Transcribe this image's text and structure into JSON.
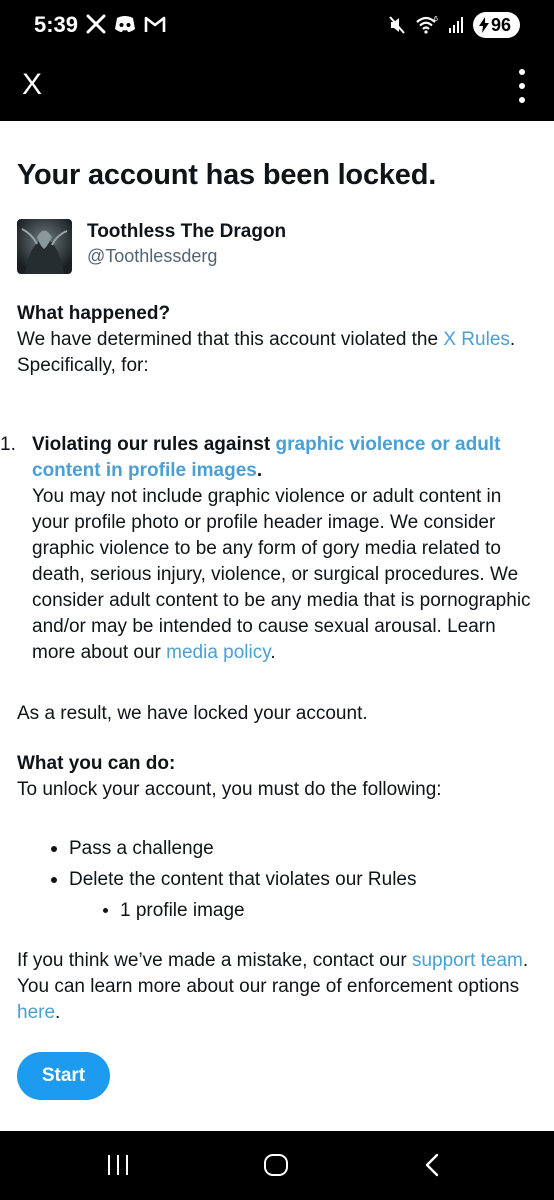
{
  "status_bar": {
    "time": "5:39",
    "battery": "96",
    "left_icons": [
      "x-logo-icon",
      "discord-icon",
      "gmail-icon"
    ],
    "right_icons": [
      "mute-icon",
      "wifi-icon",
      "signal-icon",
      "battery-icon"
    ]
  },
  "app_bar": {
    "close_icon": "close-icon",
    "close_glyph": "X",
    "more_icon": "more-vertical-icon"
  },
  "page": {
    "title": "Your account has been locked.",
    "profile": {
      "display_name": "Toothless The Dragon",
      "handle": "@Toothlessderg"
    },
    "what_happened": {
      "heading": "What happened?",
      "text_before": "We have determined that this account violated the ",
      "link": "X Rules",
      "text_after": ". Specifically, for:"
    },
    "violation": {
      "number": "1.",
      "lead": "Violating our rules against ",
      "lead_link": "graphic violence or adult content in profile images",
      "lead_end": ".",
      "body": "You may not include graphic violence or adult content in your profile photo or profile header image. We consider graphic violence to be any form of gory media related to death, serious injury, violence, or surgical procedures. We consider adult content to be any media that is pornographic and/or may be intended to cause sexual arousal. Learn more about our ",
      "body_link": "media policy",
      "body_end": "."
    },
    "result": "As a result, we have locked your account.",
    "what_you_can_do": {
      "heading": "What you can do:",
      "text": "To unlock your account, you must do the following:",
      "steps": [
        "Pass a challenge",
        "Delete the content that violates our Rules"
      ],
      "sub_steps": [
        "1 profile image"
      ]
    },
    "contact": {
      "text_before": "If you think we’ve made a mistake, contact our ",
      "link1": "support team",
      "text_middle": ". You can learn more about our range of enforcement options ",
      "link2": "here",
      "text_after": "."
    },
    "start_label": "Start"
  },
  "nav_bar": {
    "recent_icon": "recent-apps-icon",
    "home_icon": "home-icon",
    "back_icon": "back-icon"
  },
  "colors": {
    "link": "#4a9fd5",
    "button": "#1d9bf0",
    "text": "#0f1419",
    "secondary_text": "#536471"
  }
}
